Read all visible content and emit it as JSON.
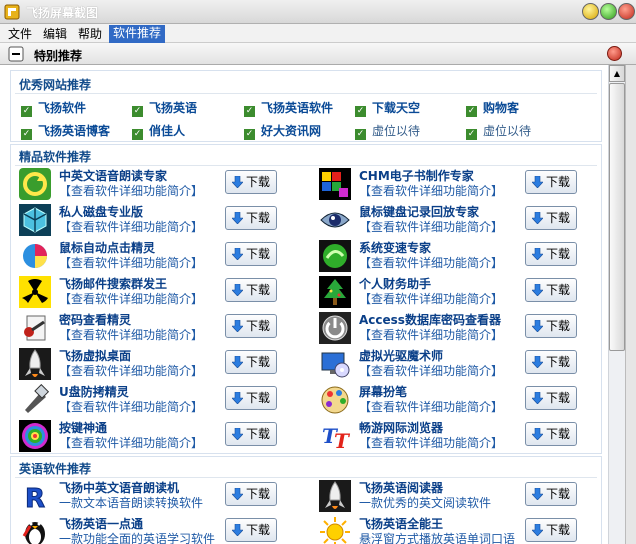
{
  "window": {
    "title": "飞扬屏幕截图"
  },
  "menu": [
    "文件",
    "编辑",
    "帮助",
    "软件推荐"
  ],
  "panel": {
    "title": "特别推荐"
  },
  "sections": {
    "sites": {
      "title": "优秀网站推荐",
      "links": [
        "飞扬软件",
        "飞扬英语",
        "飞扬英语软件",
        "下载天空",
        "购物客",
        "飞扬英语博客",
        "俏佳人",
        "好大资讯网",
        "虚位以待",
        "虚位以待"
      ]
    },
    "software": {
      "title": "精品软件推荐"
    },
    "english": {
      "title": "英语软件推荐"
    }
  },
  "download_label": "下载",
  "software": [
    {
      "name": "中英文语音朗读专家",
      "desc": "【查看软件详细功能简介】",
      "icon": "refresh-arrows-icon"
    },
    {
      "name": "CHM电子书制作专家",
      "desc": "【查看软件详细功能简介】",
      "icon": "color-cubes-icon"
    },
    {
      "name": "私人磁盘专业版",
      "desc": "【查看软件详细功能简介】",
      "icon": "cube-icon"
    },
    {
      "name": "鼠标键盘记录回放专家",
      "desc": "【查看软件详细功能简介】",
      "icon": "eye-icon"
    },
    {
      "name": "鼠标自动点击精灵",
      "desc": "【查看软件详细功能简介】",
      "icon": "pie-chart-icon"
    },
    {
      "name": "系统变速专家",
      "desc": "【查看软件详细功能简介】",
      "icon": "green-orb-icon"
    },
    {
      "name": "飞扬邮件搜索群发王",
      "desc": "【查看软件详细功能简介】",
      "icon": "radiation-icon"
    },
    {
      "name": "个人财务助手",
      "desc": "【查看软件详细功能简介】",
      "icon": "tree-icon"
    },
    {
      "name": "密码查看精灵",
      "desc": "【查看软件详细功能简介】",
      "icon": "key-document-icon"
    },
    {
      "name": "Access数据库密码查看器",
      "desc": "【查看软件详细功能简介】",
      "icon": "power-icon"
    },
    {
      "name": "飞扬虚拟桌面",
      "desc": "【查看软件详细功能简介】",
      "icon": "rocket-icon"
    },
    {
      "name": "虚拟光驱魔术师",
      "desc": "【查看软件详细功能简介】",
      "icon": "monitor-disc-icon"
    },
    {
      "name": "U盘防拷精灵",
      "desc": "【查看软件详细功能简介】",
      "icon": "usb-shield-icon"
    },
    {
      "name": "屏幕扮笔",
      "desc": "【查看软件详细功能简介】",
      "icon": "palette-icon"
    },
    {
      "name": "按键神通",
      "desc": "【查看软件详细功能简介】",
      "icon": "spiral-icon"
    },
    {
      "name": "畅游网际浏览器",
      "desc": "【查看软件详细功能简介】",
      "icon": "tt-letters-icon"
    }
  ],
  "english_software": [
    {
      "name": "飞扬中英文语音朗读机",
      "desc": "一款文本语音朗读转换软件",
      "icon": "r-letter-icon"
    },
    {
      "name": "飞扬英语阅读器",
      "desc": "一款优秀的英文阅读软件",
      "icon": "rocket-icon"
    },
    {
      "name": "飞扬英语一点通",
      "desc": "一款功能全面的英语学习软件",
      "icon": "penguin-icon"
    },
    {
      "name": "飞扬英语全能王",
      "desc": "悬浮窗方式播放英语单词口语",
      "icon": "sun-icon"
    }
  ]
}
